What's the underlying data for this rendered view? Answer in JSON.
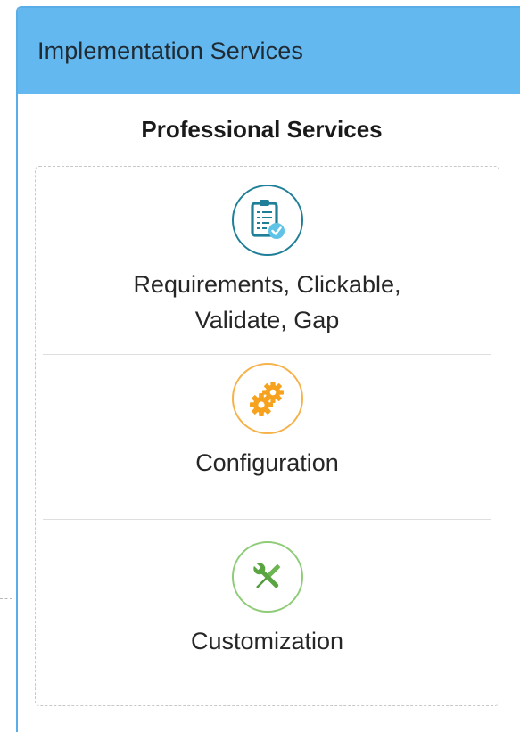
{
  "panel": {
    "title": "Implementation Services",
    "accent_color": "#63b8ef"
  },
  "section": {
    "title": "Professional Services"
  },
  "items": [
    {
      "label": "Requirements, Clickable, Validate, Gap",
      "icon": "clipboard-check-icon",
      "color": "#1f7f98"
    },
    {
      "label": "Configuration",
      "icon": "gears-icon",
      "color": "#f6a21e"
    },
    {
      "label": "Customization",
      "icon": "wrench-screwdriver-icon",
      "color": "#8fcc78"
    }
  ]
}
